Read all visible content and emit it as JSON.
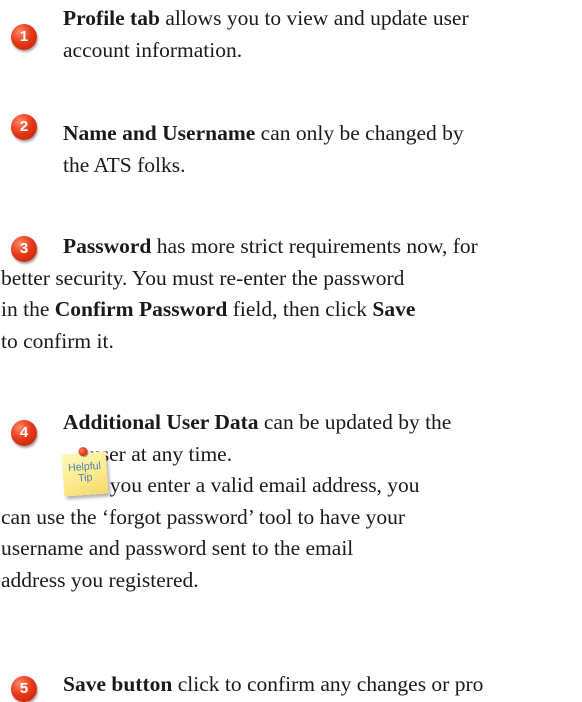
{
  "items": [
    {
      "number": "1",
      "bold": "Profile tab",
      "rest": " allows you to view and update user",
      "line2": "account information."
    },
    {
      "number": "2",
      "bold": "Name and Username",
      "rest": " can only be changed by",
      "line2": "the ATS folks."
    },
    {
      "number": "3",
      "bold": "Password",
      "rest": " has more strict requirements now, for",
      "line2": "better security.  You must re-enter the password",
      "line3_pre": "in the ",
      "line3_bold": "Confirm Password",
      "line3_mid": " field, then click ",
      "line3_bold2": "Save",
      "line4": "to confirm it."
    },
    {
      "number": "4",
      "bold": "Additional User Data",
      "rest": "  can be updated by the",
      "line2": "user at any time.",
      "line3": "If you enter a valid email address, you",
      "line4": "can use the ‘forgot password’ tool to have your",
      "line5": "username and password sent to the email",
      "line6": "address you registered."
    },
    {
      "number": "5",
      "bold": "Save button",
      "rest": "  click to confirm any changes or pro"
    }
  ],
  "tip": {
    "line1": "Helpful",
    "line2": "Tip"
  },
  "colors": {
    "badge": "#e8391a",
    "tip_note": "#fbe98a",
    "tip_text": "#4a7fb0"
  },
  "icons": {
    "badge": "numbered-red-circle-icon",
    "tip": "helpful-tip-sticky-note-icon"
  }
}
